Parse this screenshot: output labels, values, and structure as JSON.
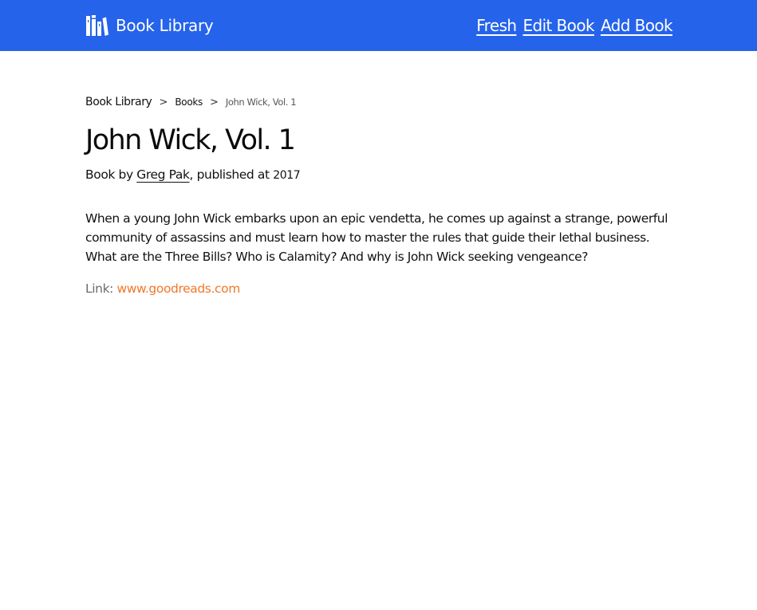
{
  "colors": {
    "navbar_bg": "#2563eb",
    "link_accent": "#f07828"
  },
  "header": {
    "logo_icon": "books-icon",
    "title": "Book Library",
    "nav": [
      {
        "label": "Fresh"
      },
      {
        "label": "Edit Book"
      },
      {
        "label": "Add Book"
      }
    ]
  },
  "breadcrumb": {
    "root": "Book Library",
    "separator": ">",
    "section": "Books",
    "current": "John Wick, Vol. 1"
  },
  "book": {
    "title": "John Wick, Vol. 1",
    "byline_prefix": "Book by ",
    "author": "Greg Pak",
    "byline_middle": ", published at ",
    "year": "2017",
    "description": "When a young John Wick embarks upon an epic vendetta, he comes up against a strange, powerful community of assassins and must learn how to master the rules that guide their lethal business. What are the Three Bills? Who is Calamity? And why is John Wick seeking vengeance?",
    "link_label": "Link: ",
    "link_text": "www.goodreads.com"
  }
}
